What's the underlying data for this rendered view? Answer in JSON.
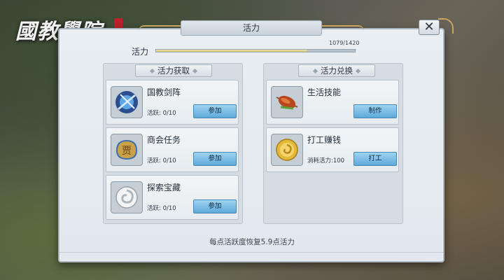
{
  "logo": {
    "text": "國教學院"
  },
  "window": {
    "title": "活力"
  },
  "vitality": {
    "label": "活力",
    "value_text": "1079/1420",
    "fraction": 0.76
  },
  "sections": {
    "left_title": "活力获取",
    "right_title": "活力兑换"
  },
  "gain": [
    {
      "name": "国教剑阵",
      "meta": "活跃: 0/10",
      "button": "参加",
      "icon": "sword-formation-icon"
    },
    {
      "name": "商会任务",
      "meta": "活跃: 0/10",
      "button": "参加",
      "icon": "merchant-seal-icon"
    },
    {
      "name": "探索宝藏",
      "meta": "活跃: 0/10",
      "button": "参加",
      "icon": "treasure-swirl-icon"
    }
  ],
  "spend": [
    {
      "name": "生活技能",
      "meta": "",
      "button": "制作",
      "icon": "roast-meat-icon"
    },
    {
      "name": "打工赚钱",
      "meta": "消耗活力:100",
      "button": "打工",
      "icon": "gold-coin-icon"
    }
  ],
  "footer": {
    "note": "每点活跃度恢复5.9点活力"
  },
  "colors": {
    "button_blue": "#5ea9da",
    "bar_gold": "#d3bf74",
    "panel": "#e6ecf0"
  }
}
